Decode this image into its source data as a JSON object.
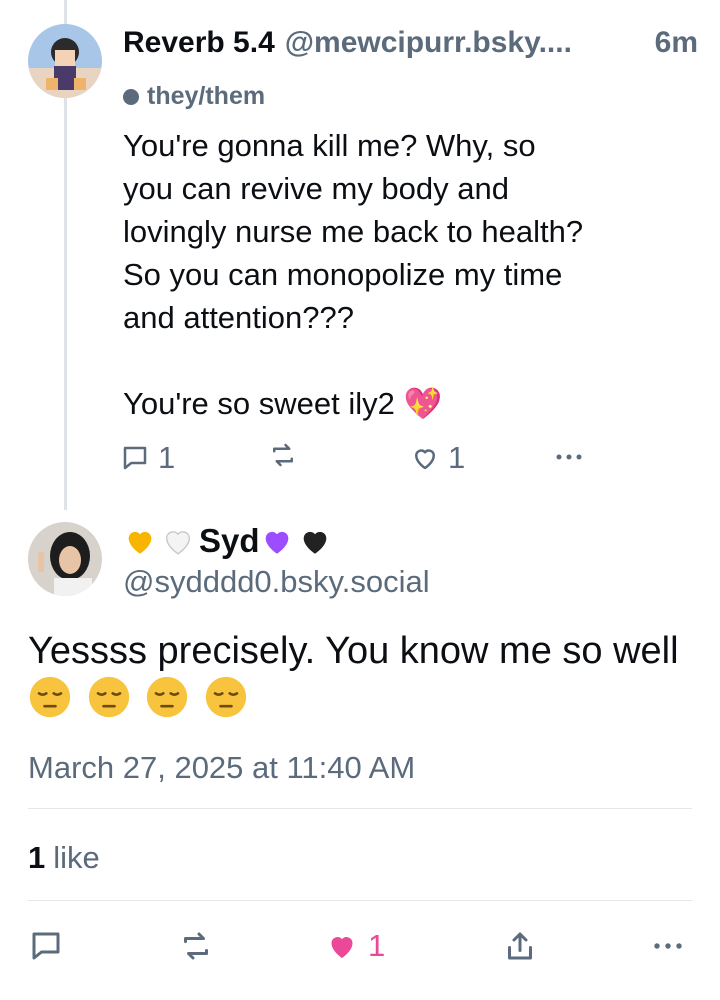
{
  "parent": {
    "display_name": "Reverb 5.4",
    "handle": "@mewcipurr.bsky....",
    "time": "6m",
    "pronouns": "they/them",
    "text": "You're gonna kill me? Why, so\nyou can revive my body and\nlovingly nurse me back to health?\nSo you can monopolize my time\nand attention???\n\nYou're so sweet ily2 💖",
    "reply_count": "1",
    "like_count": "1"
  },
  "reply": {
    "display_name": "Syd",
    "handle": "@sydddd0.bsky.social",
    "text": "Yessss precisely. You know me so well",
    "date": "March 27, 2025 at 11:40 AM",
    "likes_count": "1",
    "likes_label": "like",
    "liked_count": "1"
  },
  "icons": {
    "reply": "reply-icon",
    "repost": "repost-icon",
    "like": "heart-icon",
    "more": "more-icon",
    "share": "share-icon"
  },
  "colors": {
    "muted": "#5b6b7c",
    "accent_like": "#ec4899",
    "thread_line": "#dfe3e8"
  }
}
